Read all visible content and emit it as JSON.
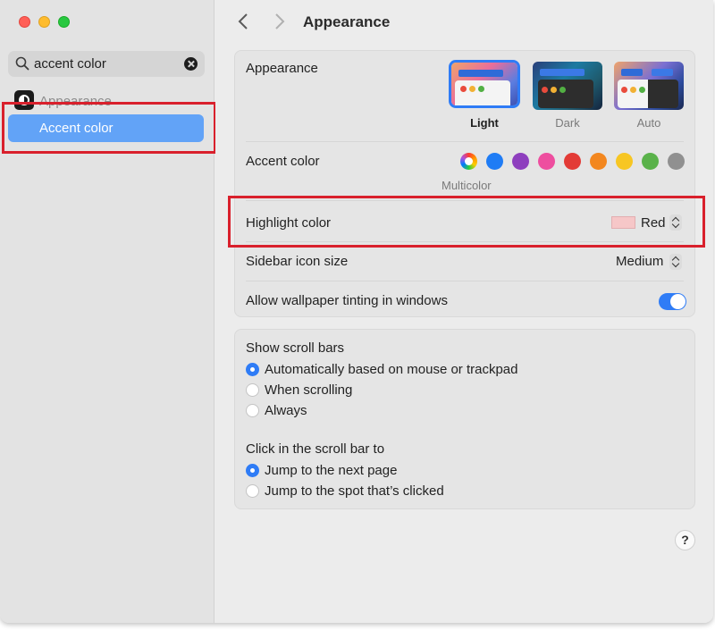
{
  "sidebar": {
    "search": {
      "value": "accent color",
      "icon": "search-icon",
      "clear_icon": "clear-icon"
    },
    "items": [
      {
        "label": "Appearance",
        "icon": "appearance-icon",
        "state": "dimmed"
      },
      {
        "label": "Accent color",
        "state": "selected"
      }
    ]
  },
  "header": {
    "title": "Appearance",
    "back_icon": "chevron-left-icon",
    "forward_icon": "chevron-right-icon"
  },
  "appearance_group": {
    "appearance": {
      "label": "Appearance",
      "options": [
        {
          "label": "Light",
          "selected": true
        },
        {
          "label": "Dark",
          "selected": false
        },
        {
          "label": "Auto",
          "selected": false
        }
      ]
    },
    "accent": {
      "label": "Accent color",
      "multicolor_label": "Multicolor",
      "swatches": [
        "multicolor",
        "#1f7cf5",
        "#8e3fbe",
        "#ee4e9f",
        "#e33b36",
        "#f3871f",
        "#f7c623",
        "#5ab24a",
        "#909090"
      ]
    },
    "highlight": {
      "label": "Highlight color",
      "value": "Red",
      "swatch_color": "#f6c7c8"
    },
    "sidebar_icon_size": {
      "label": "Sidebar icon size",
      "value": "Medium"
    },
    "wallpaper_tinting": {
      "label": "Allow wallpaper tinting in windows",
      "enabled": true
    }
  },
  "scroll_group": {
    "show_scroll_bars": {
      "label": "Show scroll bars",
      "options": [
        {
          "label": "Automatically based on mouse or trackpad",
          "selected": true
        },
        {
          "label": "When scrolling",
          "selected": false
        },
        {
          "label": "Always",
          "selected": false
        }
      ]
    },
    "click_scroll_bar": {
      "label": "Click in the scroll bar to",
      "options": [
        {
          "label": "Jump to the next page",
          "selected": true
        },
        {
          "label": "Jump to the spot that’s clicked",
          "selected": false
        }
      ]
    }
  },
  "help": {
    "label": "?"
  },
  "colors": {
    "accent": "#2f7cf6",
    "selection": "#62a3f7",
    "annotation": "#d9202c"
  }
}
